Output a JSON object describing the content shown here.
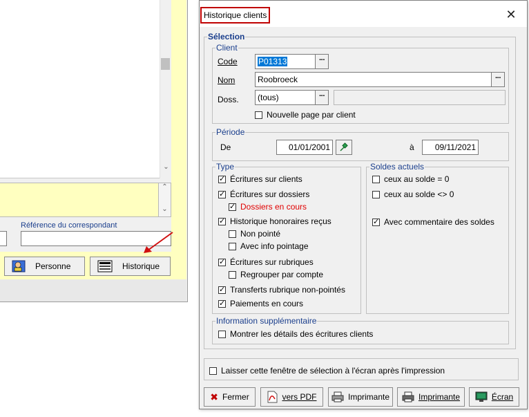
{
  "background": {
    "reference_label": "Référence du correspondant",
    "btn_personne": "Personne",
    "btn_historique": "Historique"
  },
  "dialog": {
    "title": "Historique clients",
    "selection": {
      "legend": "Sélection",
      "client": {
        "legend": "Client",
        "code_label": "Code",
        "code_value": "P01313",
        "nom_label": "Nom",
        "nom_value": "Roobroeck",
        "doss_label": "Doss.",
        "doss_value": "(tous)",
        "nouvelle_page": "Nouvelle page par client"
      },
      "periode": {
        "legend": "Période",
        "de_label": "De",
        "de_value": "01/01/2001",
        "a_label": "à",
        "a_value": "09/11/2021"
      },
      "type": {
        "legend": "Type",
        "items": [
          {
            "label": "Écritures sur clients",
            "checked": true
          },
          {
            "label": "Écritures sur dossiers",
            "checked": true
          },
          {
            "label": "Dossiers en cours",
            "checked": true
          },
          {
            "label": "Historique honoraires reçus",
            "checked": true
          },
          {
            "label": "Non pointé",
            "checked": false
          },
          {
            "label": "Avec info pointage",
            "checked": false
          },
          {
            "label": "Écritures sur rubriques",
            "checked": true
          },
          {
            "label": "Regrouper par compte",
            "checked": false
          },
          {
            "label": "Transferts rubrique non-pointés",
            "checked": true
          },
          {
            "label": "Paiements en cours",
            "checked": true
          }
        ]
      },
      "soldes": {
        "legend": "Soldes actuels",
        "items": [
          {
            "label": "ceux au solde = 0",
            "checked": false
          },
          {
            "label": "ceux au solde <> 0",
            "checked": false
          },
          {
            "label": "Avec commentaire des soldes",
            "checked": true
          }
        ]
      },
      "info": {
        "legend": "Information supplémentaire",
        "details": "Montrer les détails des écritures clients"
      }
    },
    "laisser": "Laisser cette fenêtre de sélection à l'écran après l'impression",
    "buttons": {
      "fermer": "Fermer",
      "pdf": "vers PDF",
      "imprimante1": "Imprimante",
      "imprimante2": "Imprimante",
      "ecran": "Écran"
    }
  }
}
